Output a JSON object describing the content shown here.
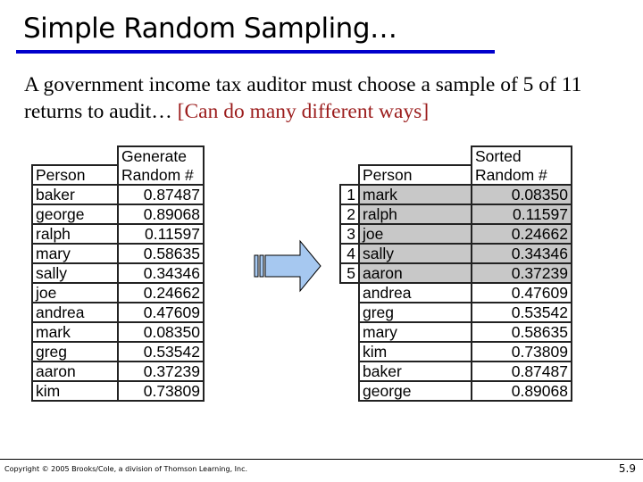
{
  "slide": {
    "title": "Simple Random Sampling…",
    "body_text": "A government income tax auditor must choose a sample of 5 of 11 returns to audit…",
    "body_highlight": "[Can do many different ways]",
    "colors": {
      "title_rule": "#0000cc",
      "highlight": "#9b1c1c",
      "selected_fill": "#c8c8c8",
      "arrow_fill": "#a6c8f0"
    }
  },
  "left_table": {
    "header_top": "Generate",
    "header_person": "Person",
    "header_random": "Random #",
    "rows": [
      {
        "person": "baker",
        "random": "0.87487"
      },
      {
        "person": "george",
        "random": "0.89068"
      },
      {
        "person": "ralph",
        "random": "0.11597"
      },
      {
        "person": "mary",
        "random": "0.58635"
      },
      {
        "person": "sally",
        "random": "0.34346"
      },
      {
        "person": "joe",
        "random": "0.24662"
      },
      {
        "person": "andrea",
        "random": "0.47609"
      },
      {
        "person": "mark",
        "random": "0.08350"
      },
      {
        "person": "greg",
        "random": "0.53542"
      },
      {
        "person": "aaron",
        "random": "0.37239"
      },
      {
        "person": "kim",
        "random": "0.73809"
      }
    ]
  },
  "arrow": {
    "icon": "right-arrow-icon"
  },
  "right_table": {
    "header_top": "Sorted",
    "header_person": "Person",
    "header_random": "Random #",
    "rows": [
      {
        "index": "1",
        "person": "mark",
        "random": "0.08350",
        "selected": true
      },
      {
        "index": "2",
        "person": "ralph",
        "random": "0.11597",
        "selected": true
      },
      {
        "index": "3",
        "person": "joe",
        "random": "0.24662",
        "selected": true
      },
      {
        "index": "4",
        "person": "sally",
        "random": "0.34346",
        "selected": true
      },
      {
        "index": "5",
        "person": "aaron",
        "random": "0.37239",
        "selected": true
      },
      {
        "index": "",
        "person": "andrea",
        "random": "0.47609",
        "selected": false
      },
      {
        "index": "",
        "person": "greg",
        "random": "0.53542",
        "selected": false
      },
      {
        "index": "",
        "person": "mary",
        "random": "0.58635",
        "selected": false
      },
      {
        "index": "",
        "person": "kim",
        "random": "0.73809",
        "selected": false
      },
      {
        "index": "",
        "person": "baker",
        "random": "0.87487",
        "selected": false
      },
      {
        "index": "",
        "person": "george",
        "random": "0.89068",
        "selected": false
      }
    ]
  },
  "footer": {
    "copyright": "Copyright © 2005 Brooks/Cole, a division of Thomson Learning, Inc.",
    "page_number": "5.9"
  }
}
